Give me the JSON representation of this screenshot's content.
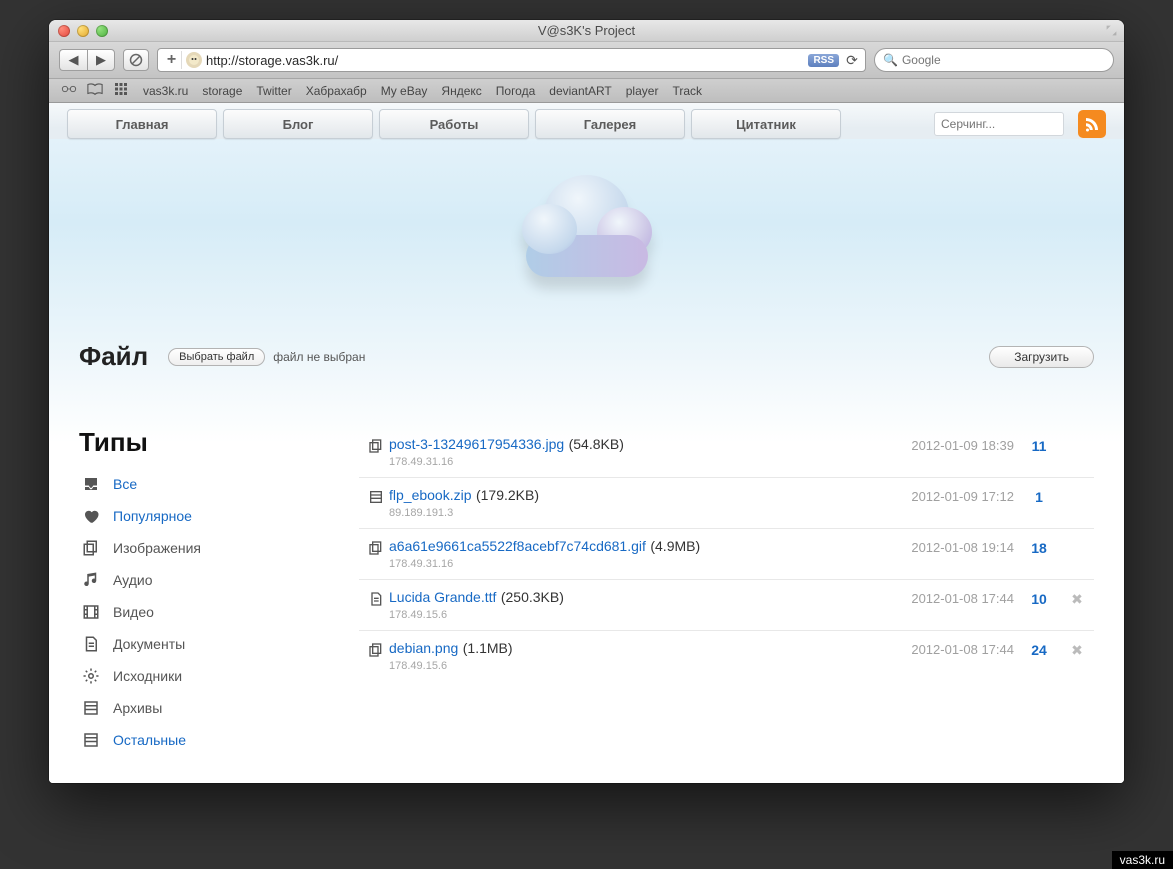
{
  "watermark": "vas3k.ru",
  "window": {
    "title": "V@s3K's Project"
  },
  "address": {
    "url": "http://storage.vas3k.ru/",
    "rss_badge": "RSS",
    "search_placeholder": "Google"
  },
  "bookmarks": [
    "vas3k.ru",
    "storage",
    "Twitter",
    "Хабрахабр",
    "My eBay",
    "Яндекс",
    "Погода",
    "deviantART",
    "player",
    "Track"
  ],
  "nav_tabs": [
    "Главная",
    "Блог",
    "Работы",
    "Галерея",
    "Цитатник"
  ],
  "site_search_placeholder": "Серчинг...",
  "file_section": {
    "heading": "Файл",
    "choose_label": "Выбрать файл",
    "no_file": "файл не выбран",
    "upload_label": "Загрузить"
  },
  "type_heading": "Типы",
  "types": [
    {
      "label": "Все",
      "link": true,
      "icon": "inbox"
    },
    {
      "label": "Популярное",
      "link": true,
      "icon": "heart"
    },
    {
      "label": "Изображения",
      "link": false,
      "icon": "copy"
    },
    {
      "label": "Аудио",
      "link": false,
      "icon": "music"
    },
    {
      "label": "Видео",
      "link": false,
      "icon": "film"
    },
    {
      "label": "Документы",
      "link": false,
      "icon": "doc"
    },
    {
      "label": "Исходники",
      "link": false,
      "icon": "gear"
    },
    {
      "label": "Архивы",
      "link": false,
      "icon": "archive"
    },
    {
      "label": "Остальные",
      "link": true,
      "icon": "archive"
    }
  ],
  "files": [
    {
      "icon": "copy",
      "name": "post-3-13249617954336.jpg",
      "size": "(54.8KB)",
      "ip": "178.49.31.16",
      "date": "2012-01-09 18:39",
      "count": "11",
      "del": false
    },
    {
      "icon": "archive",
      "name": "flp_ebook.zip",
      "size": "(179.2KB)",
      "ip": "89.189.191.3",
      "date": "2012-01-09 17:12",
      "count": "1",
      "del": false
    },
    {
      "icon": "copy",
      "name": "a6a61e9661ca5522f8acebf7c74cd681.gif",
      "size": "(4.9MB)",
      "ip": "178.49.31.16",
      "date": "2012-01-08 19:14",
      "count": "18",
      "del": false
    },
    {
      "icon": "doc",
      "name": "Lucida Grande.ttf",
      "size": "(250.3KB)",
      "ip": "178.49.15.6",
      "date": "2012-01-08 17:44",
      "count": "10",
      "del": true
    },
    {
      "icon": "copy",
      "name": "debian.png",
      "size": "(1.1MB)",
      "ip": "178.49.15.6",
      "date": "2012-01-08 17:44",
      "count": "24",
      "del": true
    }
  ]
}
